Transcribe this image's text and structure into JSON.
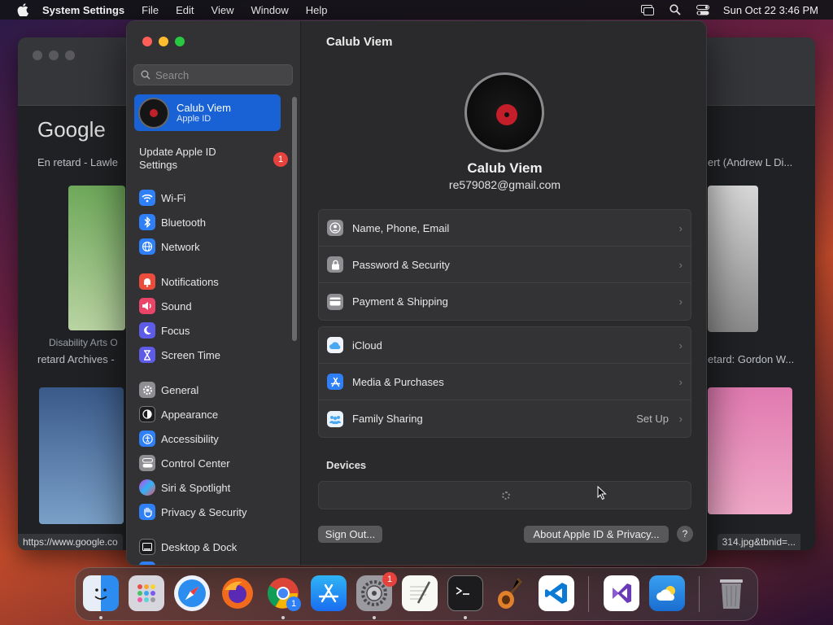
{
  "menubar": {
    "app_name": "System Settings",
    "items": [
      "File",
      "Edit",
      "View",
      "Window",
      "Help"
    ],
    "clock": "Sun Oct 22  3:46 PM"
  },
  "browser": {
    "logo_text": "Google",
    "caption_1": "En retard - Lawle",
    "caption_2": "retard Archives -",
    "caption_3": "ert (Andrew L Di...",
    "caption_4": "etard: Gordon W...",
    "thumb_caption": "Disability Arts O",
    "status_url": "https://www.google.co",
    "status_url_2": "314.jpg&tbnid=..."
  },
  "sidebar": {
    "search_placeholder": "Search",
    "account": {
      "name": "Calub Viem",
      "subtitle": "Apple ID"
    },
    "update": {
      "label_line1": "Update Apple ID",
      "label_line2": "Settings",
      "badge": "1"
    },
    "items": [
      {
        "label": "Wi-Fi"
      },
      {
        "label": "Bluetooth"
      },
      {
        "label": "Network"
      },
      {
        "label": "Notifications"
      },
      {
        "label": "Sound"
      },
      {
        "label": "Focus"
      },
      {
        "label": "Screen Time"
      },
      {
        "label": "General"
      },
      {
        "label": "Appearance"
      },
      {
        "label": "Accessibility"
      },
      {
        "label": "Control Center"
      },
      {
        "label": "Siri & Spotlight"
      },
      {
        "label": "Privacy & Security"
      },
      {
        "label": "Desktop & Dock"
      }
    ]
  },
  "main": {
    "title": "Calub Viem",
    "user_name": "Calub Viem",
    "user_email": "re579082@gmail.com",
    "group1": [
      {
        "label": "Name, Phone, Email"
      },
      {
        "label": "Password & Security"
      },
      {
        "label": "Payment & Shipping"
      }
    ],
    "group2": [
      {
        "label": "iCloud",
        "value": ""
      },
      {
        "label": "Media & Purchases",
        "value": ""
      },
      {
        "label": "Family Sharing",
        "value": "Set Up"
      }
    ],
    "devices_label": "Devices",
    "sign_out": "Sign Out...",
    "about": "About Apple ID & Privacy...",
    "help": "?"
  },
  "dock": {
    "chrome_badge": "1",
    "settings_badge": "1"
  }
}
